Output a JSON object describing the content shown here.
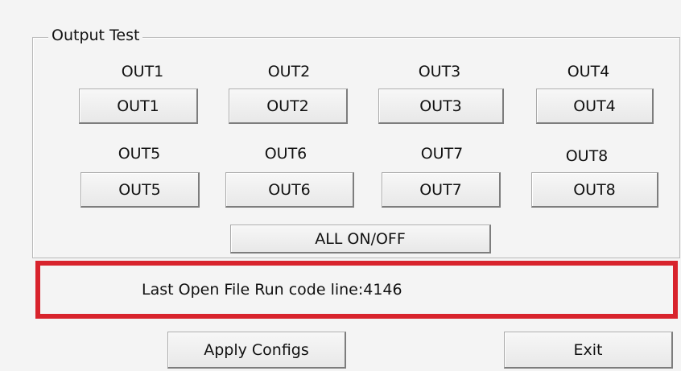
{
  "group": {
    "title": "Output Test",
    "labels": [
      "OUT1",
      "OUT2",
      "OUT3",
      "OUT4",
      "OUT5",
      "OUT6",
      "OUT7",
      "OUT8"
    ],
    "buttons": [
      "OUT1",
      "OUT2",
      "OUT3",
      "OUT4",
      "OUT5",
      "OUT6",
      "OUT7",
      "OUT8"
    ],
    "all_button": "ALL ON/OFF"
  },
  "status": {
    "text": "Last Open File Run code line:4146",
    "border_color": "#d8232c"
  },
  "footer": {
    "apply_label": "Apply Configs",
    "exit_label": "Exit"
  }
}
